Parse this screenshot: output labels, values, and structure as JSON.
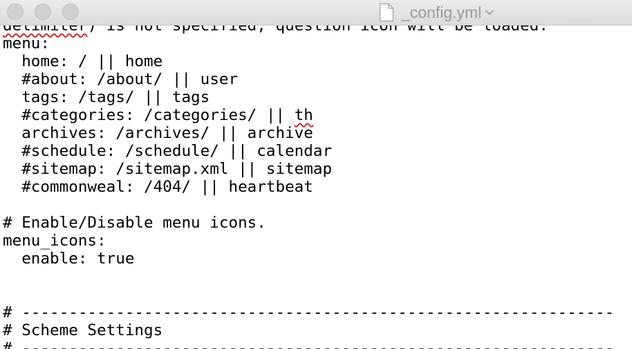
{
  "window": {
    "title": "_config.yml",
    "accent_color": "#e02020"
  },
  "editor": {
    "lines": [
      {
        "pre": "",
        "squiggle": "delimiter",
        "post": ") is not specified, question icon will be loaded."
      },
      {
        "pre": "menu:",
        "squiggle": "",
        "post": ""
      },
      {
        "pre": "  home: / || home",
        "squiggle": "",
        "post": ""
      },
      {
        "pre": "  #about: /about/ || user",
        "squiggle": "",
        "post": ""
      },
      {
        "pre": "  tags: /tags/ || tags",
        "squiggle": "",
        "post": ""
      },
      {
        "pre": "  #categories: /categories/ || ",
        "squiggle": "th",
        "post": ""
      },
      {
        "pre": "  archives: /archives/ || archive",
        "squiggle": "",
        "post": ""
      },
      {
        "pre": "  #schedule: /schedule/ || calendar",
        "squiggle": "",
        "post": ""
      },
      {
        "pre": "  #sitemap: /sitemap.xml || sitemap",
        "squiggle": "",
        "post": ""
      },
      {
        "pre": "  #commonweal: /404/ || heartbeat",
        "squiggle": "",
        "post": ""
      },
      {
        "pre": "",
        "squiggle": "",
        "post": ""
      },
      {
        "pre": "# Enable/Disable menu icons.",
        "squiggle": "",
        "post": ""
      },
      {
        "pre": "menu_icons:",
        "squiggle": "",
        "post": ""
      },
      {
        "pre": "  enable: true",
        "squiggle": "",
        "post": ""
      },
      {
        "pre": "",
        "squiggle": "",
        "post": ""
      },
      {
        "pre": "",
        "squiggle": "",
        "post": ""
      },
      {
        "pre": "# ---------------------------------------------------------------",
        "squiggle": "",
        "post": ""
      },
      {
        "pre": "# Scheme Settings",
        "squiggle": "",
        "post": ""
      },
      {
        "pre": "# ---------------------------------------------------------------",
        "squiggle": "",
        "post": ""
      }
    ]
  }
}
